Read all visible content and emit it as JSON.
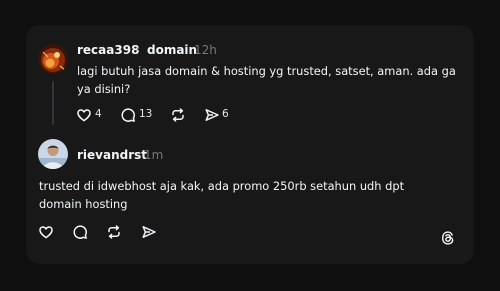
{
  "post": {
    "author": "recaa398",
    "separator": "›",
    "topic": "domain",
    "time": "12h",
    "text_line1": "lagi butuh jasa domain & hosting yg trusted, satset, aman. ada ga",
    "text_line2": "ya disini?",
    "likes": "4",
    "comments": "13",
    "shares": "6"
  },
  "reply": {
    "author": "rievandrst",
    "time": "1m",
    "text_line1": "trusted di idwebhost aja kak, ada promo 250rb setahun udh dpt",
    "text_line2": "domain hosting"
  },
  "icons": {
    "like": "heart-icon",
    "comment": "comment-icon",
    "repost": "repost-icon",
    "share": "send-icon",
    "brand": "threads-logo-icon"
  },
  "colors": {
    "background": "#0f0f10",
    "card": "#181818",
    "text": "#f3f5f7",
    "muted": "#777777",
    "thread_line": "#333638"
  }
}
